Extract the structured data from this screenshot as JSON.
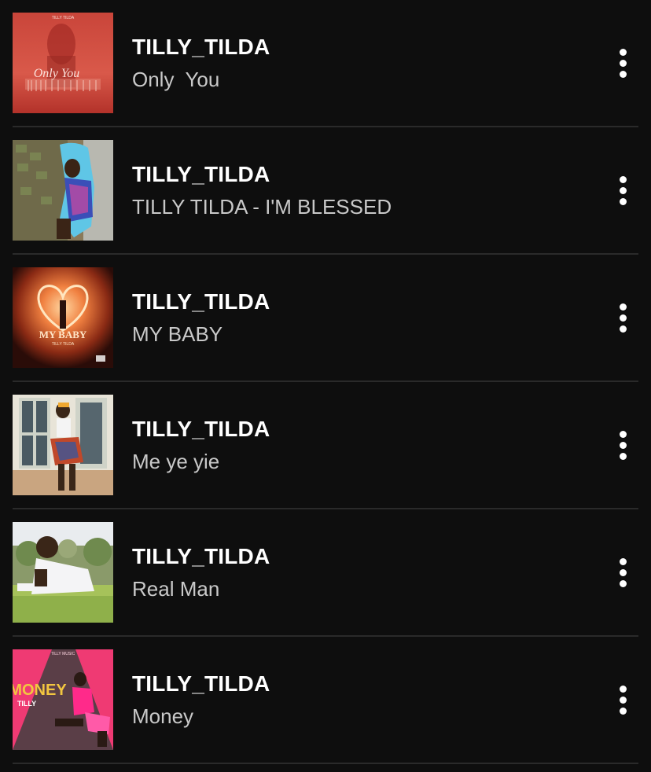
{
  "tracks": [
    {
      "artist": "TILLY_TILDA",
      "title": "Only  You",
      "cover": "only-you-cover",
      "cover_text": "Only You",
      "cover_top_text": "TILLY TILDA"
    },
    {
      "artist": "TILLY_TILDA",
      "title": "TILLY TILDA - I'M BLESSED",
      "cover": "im-blessed-cover"
    },
    {
      "artist": "TILLY_TILDA",
      "title": "MY BABY",
      "cover": "my-baby-cover",
      "cover_text": "MY BABY",
      "cover_sub_text": "TILLY TILDA"
    },
    {
      "artist": "TILLY_TILDA",
      "title": "Me ye yie",
      "cover": "me-ye-yie-cover"
    },
    {
      "artist": "TILLY_TILDA",
      "title": "Real Man",
      "cover": "real-man-cover"
    },
    {
      "artist": "TILLY_TILDA",
      "title": "Money",
      "cover": "money-cover",
      "cover_text": "MONEY",
      "cover_top_text": "TILLY MUSIC",
      "cover_sub_text": "TILLY"
    }
  ],
  "icons": {
    "more": "more-vertical-icon"
  },
  "colors": {
    "background": "#0e0e0e",
    "artist_text": "#ffffff",
    "title_text": "#c9c9c9",
    "divider": "#2a2a2a"
  }
}
